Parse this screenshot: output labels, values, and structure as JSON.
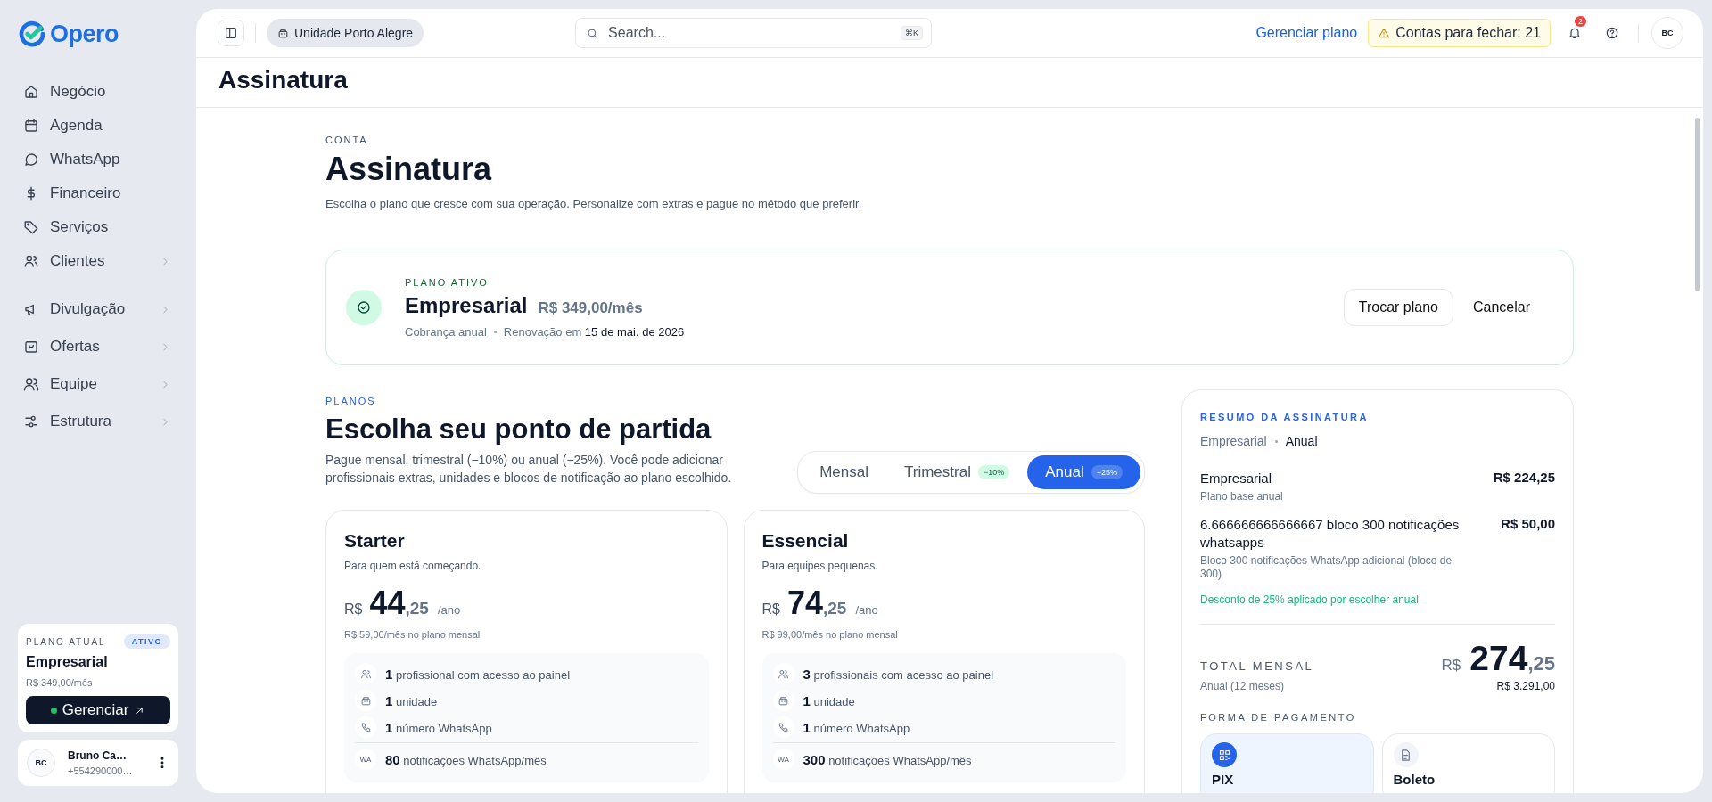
{
  "sidebar": {
    "logo": "Opero",
    "nav_groups": [
      [
        {
          "label": "Negócio",
          "has_submenu": false
        },
        {
          "label": "Agenda",
          "has_submenu": false
        },
        {
          "label": "WhatsApp",
          "has_submenu": false
        },
        {
          "label": "Financeiro",
          "has_submenu": false
        },
        {
          "label": "Serviços",
          "has_submenu": false
        },
        {
          "label": "Clientes",
          "has_submenu": true
        }
      ],
      [
        {
          "label": "Divulgação",
          "has_submenu": true
        },
        {
          "label": "Ofertas",
          "has_submenu": true
        },
        {
          "label": "Equipe",
          "has_submenu": true
        },
        {
          "label": "Estrutura",
          "has_submenu": true
        }
      ]
    ],
    "plan_card": {
      "label": "PLANO ATUAL",
      "badge": "ATIVO",
      "name": "Empresarial",
      "price": "R$ 349,00/mês",
      "button": "Gerenciar"
    },
    "user": {
      "initials": "BC",
      "name": "Bruno Ca…",
      "phone": "+554290000…"
    }
  },
  "header": {
    "unit": "Unidade Porto Alegre",
    "search": {
      "placeholder": "Search...",
      "shortcut": "⌘K"
    },
    "manage_link": "Gerenciar plano",
    "alert": "Contas para fechar: 21",
    "notification_count": "2",
    "avatar": "BC"
  },
  "page_title": "Assinatura",
  "intro": {
    "eyebrow": "CONTA",
    "title": "Assinatura",
    "subtitle": "Escolha o plano que cresce com sua operação. Personalize com extras e pague no método que preferir."
  },
  "active_plan": {
    "label": "PLANO ATIVO",
    "name": "Empresarial",
    "price": "R$ 349,00/mês",
    "billing": "Cobrança anual",
    "renewal": "Renovação em **15 de mai. de 2026**",
    "buttons": [
      "Trocar plano",
      "Cancelar"
    ]
  },
  "plans": {
    "eyebrow": "PLANOS",
    "title": "Escolha seu ponto de partida",
    "description": "Pague mensal, trimestral (−10%) ou anual (−25%). Você pode adicionar profissionais extras, unidades e blocos de notificação ao plano escolhido.",
    "billing_options": [
      {
        "label": "Mensal",
        "selected": false
      },
      {
        "label": "Trimestral",
        "badge": "−10%",
        "selected": false
      },
      {
        "label": "Anual",
        "badge": "−25%",
        "selected": true
      }
    ],
    "cards": [
      {
        "name": "Starter",
        "tagline": "Para quem está começando.",
        "currency": "R$",
        "amount": "44",
        "cents": ",25",
        "period": "/ano",
        "note": "R$ 59,00/mês no plano mensal",
        "features": [
          {
            "kind": "people",
            "count": "1",
            "text": "profissional com acesso ao painel"
          },
          {
            "kind": "building",
            "count": "1",
            "text": "unidade"
          },
          {
            "kind": "phone",
            "count": "1",
            "text": "número WhatsApp"
          },
          {
            "kind": "tag",
            "tag": "WA",
            "count": "80",
            "text": "notificações WhatsApp/mês"
          }
        ]
      },
      {
        "name": "Essencial",
        "tagline": "Para equipes pequenas.",
        "currency": "R$",
        "amount": "74",
        "cents": ",25",
        "period": "/ano",
        "note": "R$ 99,00/mês no plano mensal",
        "features": [
          {
            "kind": "people",
            "count": "3",
            "text": "profissionais com acesso ao painel"
          },
          {
            "kind": "building",
            "count": "1",
            "text": "unidade"
          },
          {
            "kind": "phone",
            "count": "1",
            "text": "número WhatsApp"
          },
          {
            "kind": "tag",
            "tag": "WA",
            "count": "300",
            "text": "notificações WhatsApp/mês"
          }
        ]
      }
    ]
  },
  "summary": {
    "label": "RESUMO DA ASSINATURA",
    "plan": "Empresarial",
    "cycle": "Anual",
    "lines": [
      {
        "title": "Empresarial",
        "subtitle": "Plano base anual",
        "price": "R$ 224,25"
      },
      {
        "title": "6.666666666666667 bloco 300 notificações whatsapps",
        "subtitle": "Bloco 300 notificações WhatsApp adicional (bloco de 300)",
        "price": "R$ 50,00"
      }
    ],
    "discount_note": "Desconto de 25% aplicado por escolher anual",
    "total_label": "TOTAL MENSAL",
    "total_currency": "R$",
    "total_amount": "274",
    "total_cents": ",25",
    "total_period": "Anual (12 meses)",
    "total_year": "R$ 3.291,00",
    "payment_label": "FORMA DE PAGAMENTO",
    "payment_methods": [
      {
        "label": "PIX",
        "kind": "pix",
        "selected": true
      },
      {
        "label": "Boleto",
        "kind": "boleto",
        "selected": false
      }
    ]
  }
}
